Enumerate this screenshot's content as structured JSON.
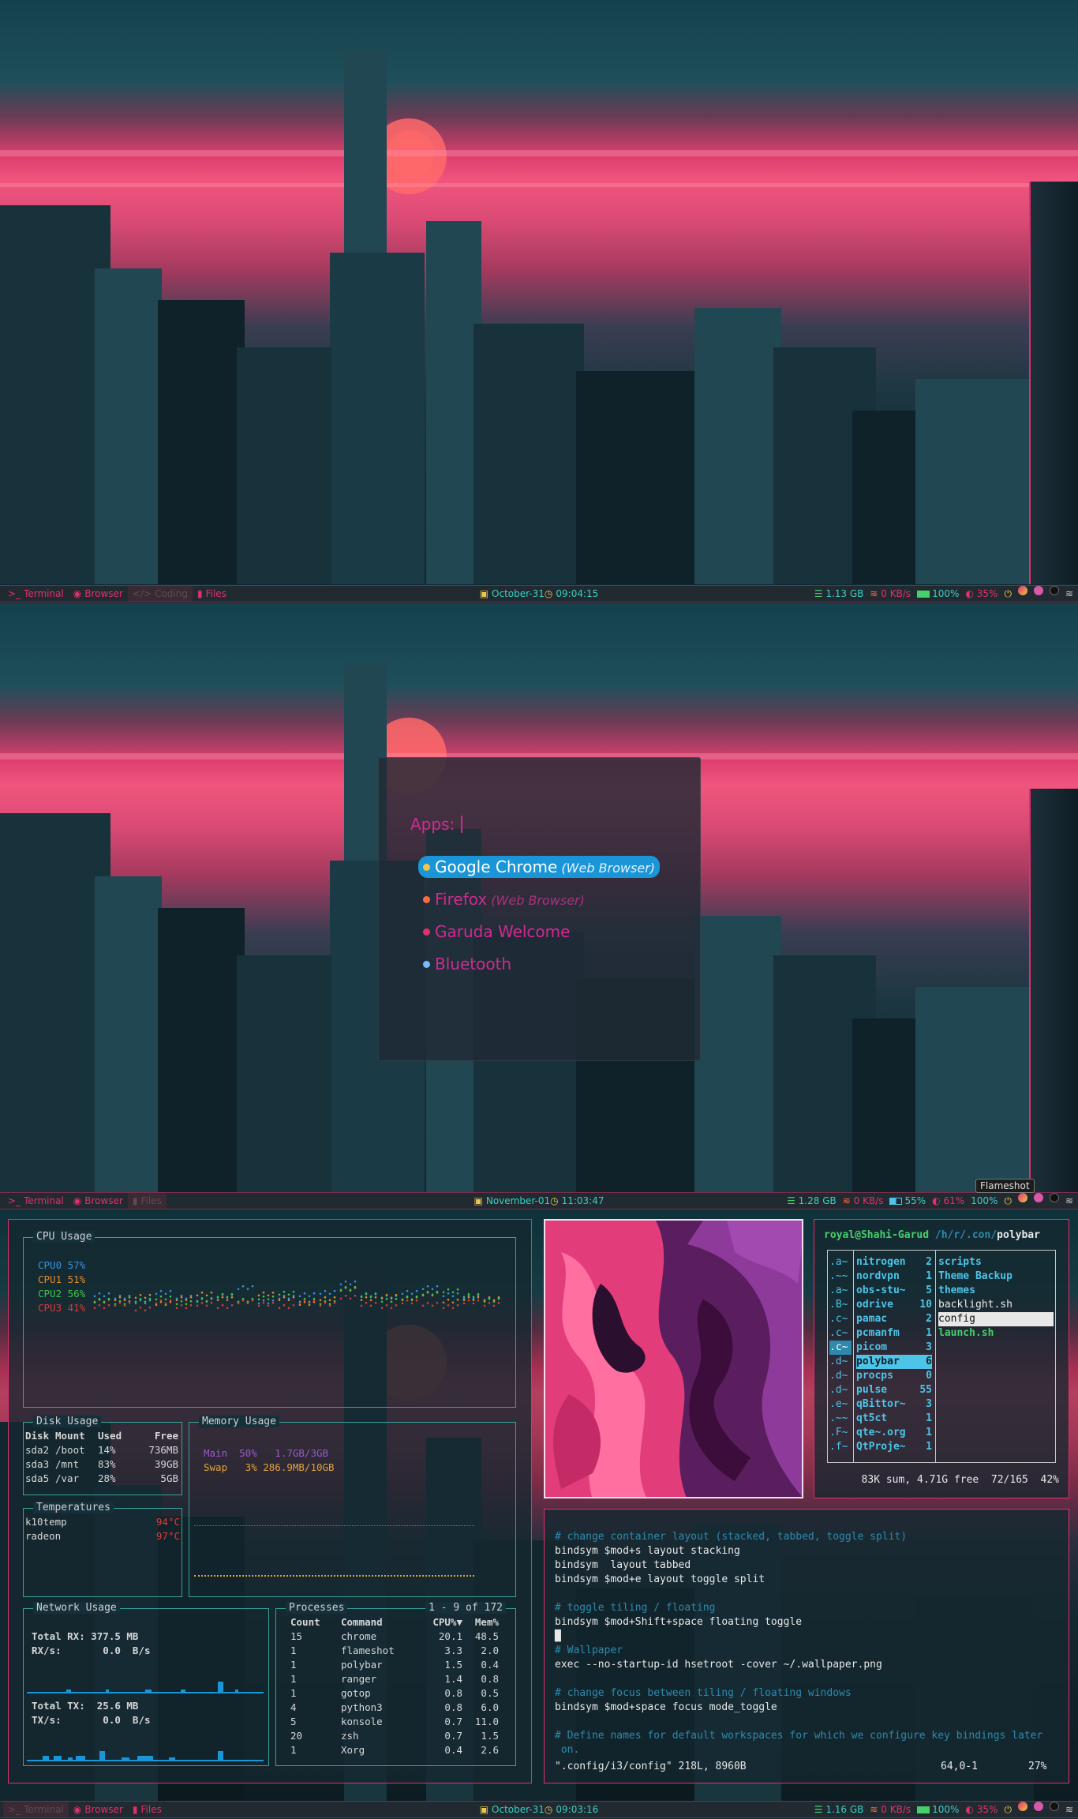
{
  "colors": {
    "accent": "#e0306b",
    "cyan": "#33d1c4",
    "blue": "#1a95d8",
    "yellow": "#e6c84a",
    "magenta": "#d12a8f"
  },
  "bar1": {
    "workspaces": [
      {
        "glyph": ">_",
        "label": "Terminal"
      },
      {
        "glyph": "◉",
        "label": "Browser"
      },
      {
        "glyph": "</>",
        "label": "Coding",
        "active": true
      },
      {
        "glyph": "▮",
        "label": "Files"
      }
    ],
    "date": "October-31",
    "time": "09:04:15",
    "memory": "1.13 GB",
    "net": "0 KB/s",
    "battery": "100%",
    "cpu": "35%"
  },
  "rofi": {
    "prompt": "Apps:",
    "items": [
      {
        "name": "Google Chrome",
        "desc": "(Web Browser)",
        "selected": true,
        "icon": "chrome-icon"
      },
      {
        "name": "Firefox",
        "desc": "(Web Browser)",
        "icon": "firefox-icon"
      },
      {
        "name": "Garuda Welcome",
        "desc": "",
        "icon": "garuda-icon"
      },
      {
        "name": "Bluetooth",
        "desc": "",
        "icon": "bluetooth-icon"
      }
    ]
  },
  "bar2": {
    "workspaces": [
      {
        "glyph": ">_",
        "label": "Terminal"
      },
      {
        "glyph": "◉",
        "label": "Browser"
      },
      {
        "glyph": "▮",
        "label": "Files",
        "active": true
      }
    ],
    "date": "November-01",
    "time": "11:03:47",
    "memory": "1.28 GB",
    "net": "0 KB/s",
    "battery": "55%",
    "cpu": "61%",
    "battery2": "100%",
    "tooltip": "Flameshot"
  },
  "bar3": {
    "workspaces": [
      {
        "glyph": ">_",
        "label": "Terminal",
        "active": true
      },
      {
        "glyph": "◉",
        "label": "Browser"
      },
      {
        "glyph": "▮",
        "label": "Files"
      }
    ],
    "date": "October-31",
    "time": "09:03:16",
    "memory": "1.16 GB",
    "net": "0 KB/s",
    "battery": "100%",
    "cpu": "35%"
  },
  "btop": {
    "cpu_title": "CPU Usage",
    "cpus": [
      {
        "label": "CPU0 57%",
        "color": "#3a8fd8"
      },
      {
        "label": "CPU1 51%",
        "color": "#e08a2a"
      },
      {
        "label": "CPU2 56%",
        "color": "#45c04a"
      },
      {
        "label": "CPU3 41%",
        "color": "#d63a3a"
      }
    ],
    "disk_title": "Disk Usage",
    "disk_headers": [
      "Disk",
      "Mount",
      "Used",
      "Free"
    ],
    "disks": [
      [
        "sda2",
        "/boot",
        "14%",
        "736MB"
      ],
      [
        "sda3",
        "/mnt",
        "83%",
        "39GB"
      ],
      [
        "sda5",
        "/var",
        "28%",
        "5GB"
      ]
    ],
    "memory_title": "Memory Usage",
    "memory": [
      {
        "label": "Main  50%   1.7GB/3GB",
        "color": "#9a59c8"
      },
      {
        "label": "Swap   3% 286.9MB/10GB",
        "color": "#e0a23a"
      }
    ],
    "temps_title": "Temperatures",
    "temps": [
      [
        "k10temp",
        "94°C"
      ],
      [
        "radeon",
        "97°C"
      ]
    ],
    "net_title": "Network Usage",
    "net": {
      "rx_total": "Total RX: 377.5 MB",
      "rx": "RX/s:       0.0  B/s",
      "tx_total": "Total TX:  25.6 MB",
      "tx": "TX/s:       0.0  B/s"
    },
    "proc_title": "Processes",
    "proc_range": "1 - 9 of 172",
    "proc_headers": [
      "Count",
      "Command",
      "CPU%▼",
      "Mem%"
    ],
    "procs": [
      [
        "15",
        "chrome",
        "20.1",
        "48.5"
      ],
      [
        "1",
        "flameshot",
        "3.3",
        "2.0"
      ],
      [
        "1",
        "polybar",
        "1.5",
        "0.4"
      ],
      [
        "1",
        "ranger",
        "1.4",
        "0.8"
      ],
      [
        "1",
        "gotop",
        "0.8",
        "0.5"
      ],
      [
        "4",
        "python3",
        "0.8",
        "6.0"
      ],
      [
        "5",
        "konsole",
        "0.7",
        "11.0"
      ],
      [
        "20",
        "zsh",
        "0.7",
        "1.5"
      ],
      [
        "1",
        "Xorg",
        "0.4",
        "2.6"
      ]
    ]
  },
  "ranger": {
    "user": "royal@Shahi-Garud",
    "path": "/h/r/.con/",
    "cwd": "polybar",
    "col1": [
      ".a~",
      ".~~",
      ".a~",
      ".B~",
      ".c~",
      ".c~",
      ".c~",
      ".d~",
      ".d~",
      ".d~",
      ".e~",
      ".~~",
      ".F~",
      ".f~"
    ],
    "col2": [
      [
        "nitrogen",
        "2"
      ],
      [
        "nordvpn",
        "1"
      ],
      [
        "obs-stu~",
        "5"
      ],
      [
        "odrive",
        "10"
      ],
      [
        "pamac",
        "2"
      ],
      [
        "pcmanfm",
        "1"
      ],
      [
        "picom",
        "3"
      ],
      [
        "polybar",
        "6"
      ],
      [
        "procps",
        "0"
      ],
      [
        "pulse",
        "55"
      ],
      [
        "qBittor~",
        "3"
      ],
      [
        "qt5ct",
        "1"
      ],
      [
        "qte~.org",
        "1"
      ],
      [
        "QtProje~",
        "1"
      ]
    ],
    "col3": [
      {
        "name": "scripts",
        "type": "dir"
      },
      {
        "name": "Theme Backup",
        "type": "dir"
      },
      {
        "name": "themes",
        "type": "dir"
      },
      {
        "name": "backlight.sh",
        "type": "file"
      },
      {
        "name": "config",
        "type": "sel"
      },
      {
        "name": "launch.sh",
        "type": "exec"
      }
    ],
    "status": "83K sum, 4.71G free  72/165  42%"
  },
  "vim": {
    "lines": [
      {
        "t": "# change container layout (stacked, tabbed, toggle split)",
        "c": true
      },
      {
        "t": "bindsym $mod+s layout stacking"
      },
      {
        "t": "bindsym  layout tabbed"
      },
      {
        "t": "bindsym $mod+e layout toggle split"
      },
      {
        "t": ""
      },
      {
        "t": "# toggle tiling / floating",
        "c": true
      },
      {
        "t": "bindsym $mod+Shift+space floating toggle"
      },
      {
        "t": "█"
      },
      {
        "t": "# Wallpaper",
        "c": true
      },
      {
        "t": "exec --no-startup-id hsetroot -cover ~/.wallpaper.png"
      },
      {
        "t": ""
      },
      {
        "t": "# change focus between tiling / floating windows",
        "c": true
      },
      {
        "t": "bindsym $mod+space focus mode_toggle"
      },
      {
        "t": ""
      },
      {
        "t": "# Define names for default workspaces for which we configure key bindings later",
        "c": true
      },
      {
        "t": " on.",
        "c": true
      }
    ],
    "status_file": "\".config/i3/config\" 218L, 8960B",
    "status_pos": "64,0-1",
    "status_pct": "27%"
  }
}
